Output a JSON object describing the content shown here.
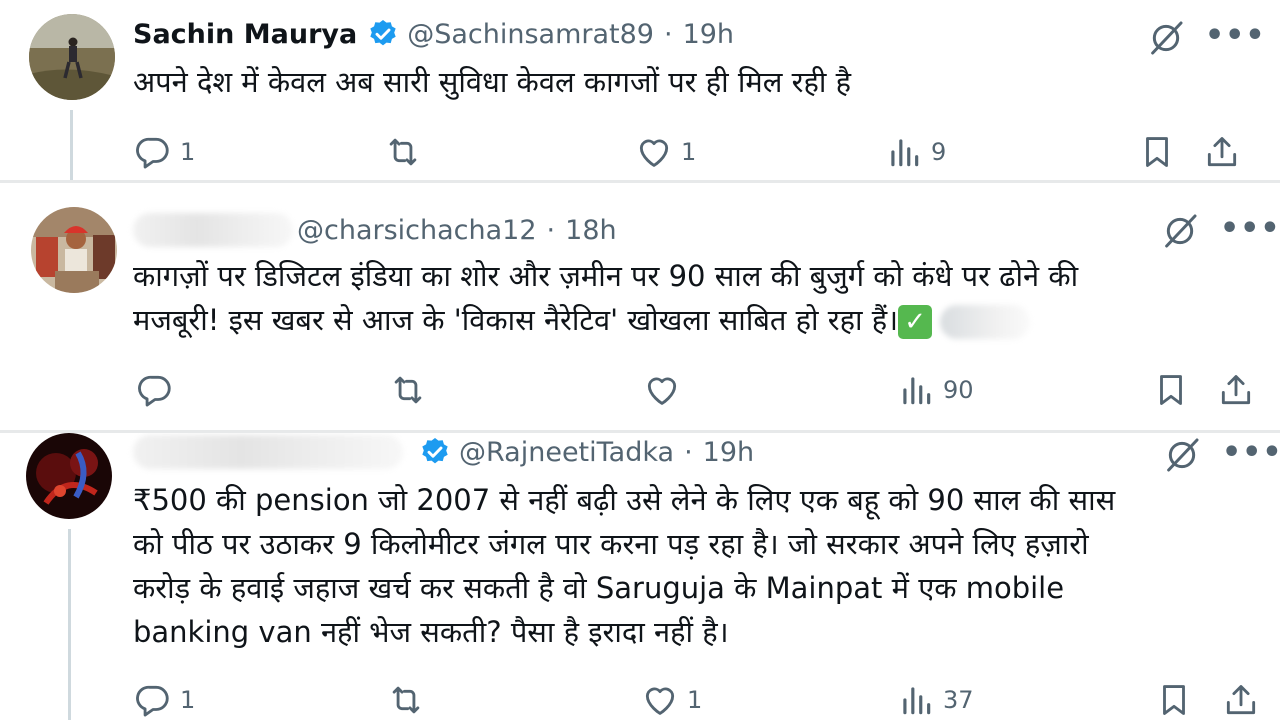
{
  "tweets": [
    {
      "name": "Sachin Maurya",
      "handle": "@Sachinsamrat89",
      "separator": "·",
      "time": "19h",
      "lines": [
        "अपने देश में केवल अब सारी सुविधा केवल कागजों पर ही मिल रही है"
      ],
      "replies": "1",
      "reposts": "",
      "likes": "1",
      "views": "9"
    },
    {
      "handle": "@charsichacha12",
      "separator": "·",
      "time": "18h",
      "lines": [
        "कागज़ों पर डिजिटल इंडिया का शोर और ज़मीन पर 90 साल की बुजुर्ग को कंधे पर ढोने की",
        "मजबूरी! इस खबर से आज के 'विकास नैरेटिव' खोखला साबित हो रहा हैं।"
      ],
      "check_emoji": "✓",
      "replies": "",
      "reposts": "",
      "likes": "",
      "views": "90"
    },
    {
      "handle": "@RajneetiTadka",
      "separator": "·",
      "time": "19h",
      "lines": [
        "₹500 की pension जो 2007 से नहीं बढ़ी उसे लेने के लिए एक बहू को 90 साल की सास",
        "को पीठ पर उठाकर 9 किलोमीटर जंगल पार करना पड़ रहा है। जो सरकार अपने लिए हज़ारो",
        "करोड़ के हवाई जहाज खर्च कर सकती है वो Saruguja के Mainpat में एक mobile",
        "banking van नहीं भेज सकती? पैसा है इरादा नहीं है।"
      ],
      "replies": "1",
      "reposts": "",
      "likes": "1",
      "views": "37"
    }
  ],
  "icons": [
    "verified-badge-icon",
    "grok-icon",
    "more-icon",
    "reply-icon",
    "repost-icon",
    "like-icon",
    "views-icon",
    "bookmark-icon",
    "share-icon"
  ],
  "colors": {
    "verified": "#1d9bf0",
    "muted": "#536471",
    "text": "#0f1419"
  }
}
